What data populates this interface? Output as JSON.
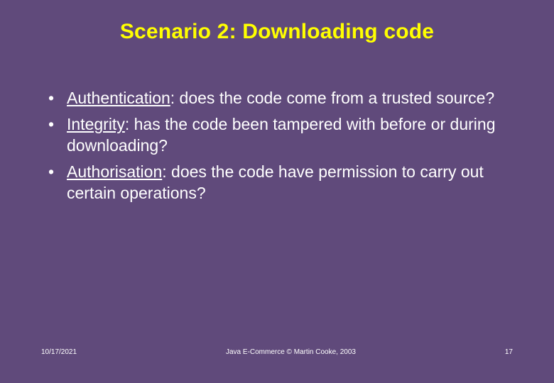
{
  "title": "Scenario 2: Downloading code",
  "bullets": [
    {
      "term": "Authentication",
      "rest": ": does the code come from a trusted source?"
    },
    {
      "term": "Integrity",
      "rest": ": has the code been tampered with before or during downloading?"
    },
    {
      "term": "Authorisation",
      "rest": ": does the code have permission to carry out certain operations?"
    }
  ],
  "footer": {
    "date": "10/17/2021",
    "center": "Java E-Commerce © Martin Cooke, 2003",
    "page": "17"
  }
}
